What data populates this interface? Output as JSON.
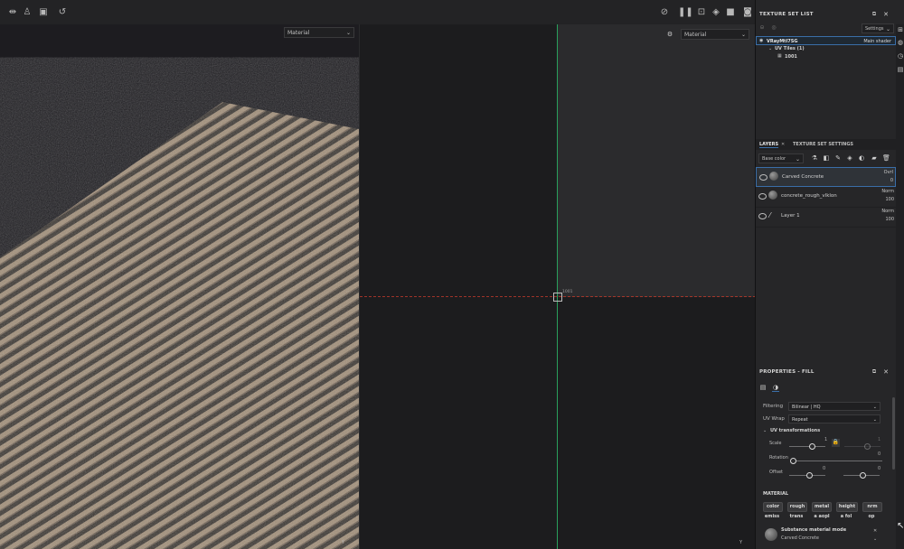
{
  "toolbar": {
    "left_icons": [
      "mirror-icon",
      "figure-icon",
      "frame-icon",
      "history-icon"
    ],
    "right_icons": [
      "hide-icon",
      "pause-icon",
      "camera-settings-icon",
      "cube-icon",
      "video-icon",
      "screenshot-icon"
    ]
  },
  "viewport3d": {
    "material_select": "Material",
    "axis_label": "Y"
  },
  "viewport2d": {
    "material_select": "Material",
    "tile_label": "1001",
    "axis_label": "Y"
  },
  "texture_set_list": {
    "title": "TEXTURE SET LIST",
    "settings_label": "Settings",
    "set_name": "VRayMtl7SG",
    "shader_label": "Main shader",
    "uv_tiles_label": "UV Tiles (1)",
    "tile_name": "1001"
  },
  "layers": {
    "tab_layers": "LAYERS",
    "tab_texture_set_settings": "TEXTURE SET SETTINGS",
    "channel_select": "Base color",
    "items": [
      {
        "name": "Carved Concrete",
        "blend": "Ovrl",
        "opacity": "0"
      },
      {
        "name": "concrete_rough_vlklon",
        "blend": "Norm",
        "opacity": "100"
      },
      {
        "name": "Layer 1",
        "blend": "Norm",
        "opacity": "100"
      }
    ]
  },
  "properties": {
    "title": "PROPERTIES - FILL",
    "filtering_label": "Filtering",
    "filtering_value": "Bilinear | HQ",
    "uv_wrap_label": "UV Wrap",
    "uv_wrap_value": "Repeat",
    "uv_transformations_label": "UV transformations",
    "scale_label": "Scale",
    "scale_value": "1",
    "scale_value2": "1",
    "rotation_label": "Rotation",
    "rotation_value": "0",
    "offset_label": "Offset",
    "offset_value": "0",
    "offset_value2": "0",
    "material_header": "MATERIAL",
    "material_buttons_row1": [
      "color",
      "rough",
      "metal",
      "height",
      "nrm"
    ],
    "material_buttons_row2": [
      "emiss",
      "trans",
      "a aopl",
      "a fol",
      "op"
    ],
    "substance_mode_label": "Substance material mode",
    "substance_name": "Carved Concrete"
  },
  "colors": {
    "accent_blue": "#3a6ea8",
    "axis_red": "#c0392b",
    "axis_green": "#2ecc71"
  }
}
